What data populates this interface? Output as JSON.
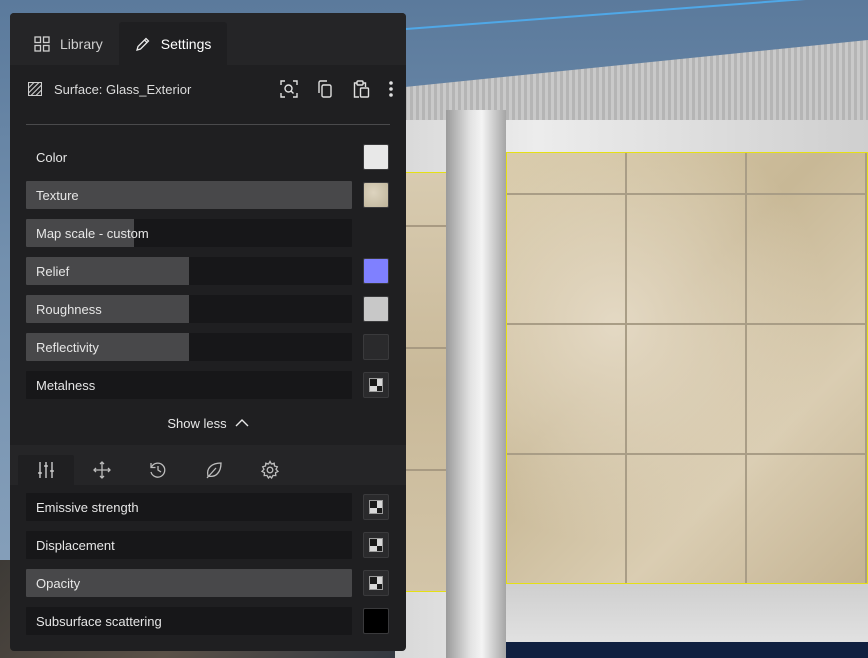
{
  "tabs": [
    {
      "label": "Library",
      "icon": "grid-icon",
      "active": false
    },
    {
      "label": "Settings",
      "icon": "pencil-icon",
      "active": true
    }
  ],
  "surface": {
    "title": "Surface: Glass_Exterior",
    "icon": "hatch-icon",
    "actions": [
      "focus-icon",
      "copy-icon",
      "paste-icon",
      "more-vertical-icon"
    ]
  },
  "properties": [
    {
      "label": "Color",
      "fill": 0,
      "swatch": "#e8e8e8",
      "swatch_type": "color"
    },
    {
      "label": "Texture",
      "fill": 1.0,
      "swatch": "#cfc6b0",
      "swatch_type": "texture"
    },
    {
      "label": "Map scale - custom",
      "fill": 0.33,
      "swatch_type": "none"
    },
    {
      "label": "Relief",
      "fill": 0.5,
      "swatch": "#7f80ff",
      "swatch_type": "color"
    },
    {
      "label": "Roughness",
      "fill": 0.5,
      "swatch": "#c8c8c8",
      "swatch_type": "color"
    },
    {
      "label": "Reflectivity",
      "fill": 0.5,
      "swatch": "#2a2a2c",
      "swatch_type": "color"
    },
    {
      "label": "Metalness",
      "fill": 0,
      "swatch_type": "checker"
    }
  ],
  "show_less_label": "Show less",
  "icon_tabs": [
    "sliders-icon",
    "move-icon",
    "history-icon",
    "leaf-icon",
    "gear-icon"
  ],
  "extra_properties": [
    {
      "label": "Emissive strength",
      "fill": 0,
      "swatch_type": "checker"
    },
    {
      "label": "Displacement",
      "fill": 0,
      "swatch_type": "checker"
    },
    {
      "label": "Opacity",
      "fill": 1.0,
      "swatch_type": "checker"
    },
    {
      "label": "Subsurface scattering",
      "fill": 0,
      "swatch": "#000000",
      "swatch_type": "color"
    }
  ]
}
